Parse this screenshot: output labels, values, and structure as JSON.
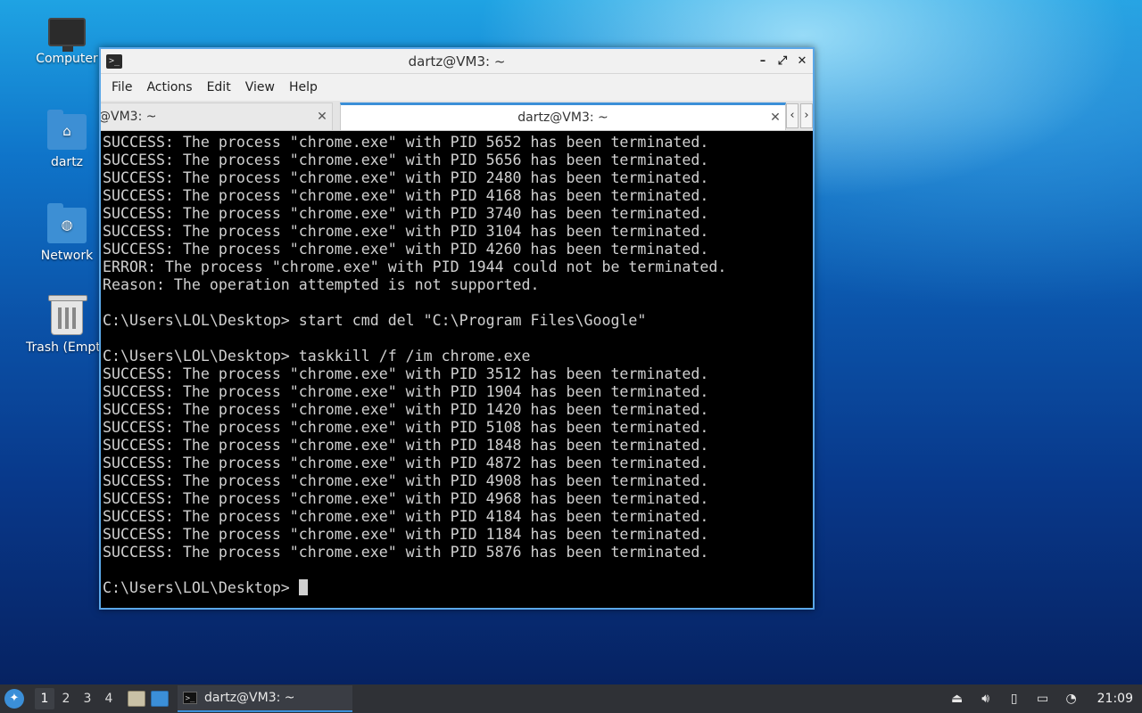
{
  "desktop": {
    "icons": [
      {
        "label": "Computer",
        "icon": "computer-icon"
      },
      {
        "label": "dartz",
        "icon": "home-folder-icon"
      },
      {
        "label": "Network",
        "icon": "network-folder-icon"
      },
      {
        "label": "Trash (Empt",
        "icon": "trash-icon"
      }
    ]
  },
  "window": {
    "title": "dartz@VM3: ~",
    "controls": {
      "minimize": "–",
      "maximize": "⤢",
      "close": "✕"
    },
    "menu": [
      "File",
      "Actions",
      "Edit",
      "View",
      "Help"
    ],
    "tabs": [
      {
        "label": "@VM3: ~",
        "close": "✕",
        "active": false
      },
      {
        "label": "dartz@VM3: ~",
        "close": "✕",
        "active": true
      }
    ],
    "tab_scroll": {
      "left": "‹",
      "right": "›"
    }
  },
  "terminal": {
    "lines": [
      "SUCCESS: The process \"chrome.exe\" with PID 5652 has been terminated.",
      "SUCCESS: The process \"chrome.exe\" with PID 5656 has been terminated.",
      "SUCCESS: The process \"chrome.exe\" with PID 2480 has been terminated.",
      "SUCCESS: The process \"chrome.exe\" with PID 4168 has been terminated.",
      "SUCCESS: The process \"chrome.exe\" with PID 3740 has been terminated.",
      "SUCCESS: The process \"chrome.exe\" with PID 3104 has been terminated.",
      "SUCCESS: The process \"chrome.exe\" with PID 4260 has been terminated.",
      "ERROR: The process \"chrome.exe\" with PID 1944 could not be terminated.",
      "Reason: The operation attempted is not supported.",
      "",
      "C:\\Users\\LOL\\Desktop> start cmd del \"C:\\Program Files\\Google\"",
      "",
      "C:\\Users\\LOL\\Desktop> taskkill /f /im chrome.exe",
      "SUCCESS: The process \"chrome.exe\" with PID 3512 has been terminated.",
      "SUCCESS: The process \"chrome.exe\" with PID 1904 has been terminated.",
      "SUCCESS: The process \"chrome.exe\" with PID 1420 has been terminated.",
      "SUCCESS: The process \"chrome.exe\" with PID 5108 has been terminated.",
      "SUCCESS: The process \"chrome.exe\" with PID 1848 has been terminated.",
      "SUCCESS: The process \"chrome.exe\" with PID 4872 has been terminated.",
      "SUCCESS: The process \"chrome.exe\" with PID 4908 has been terminated.",
      "SUCCESS: The process \"chrome.exe\" with PID 4968 has been terminated.",
      "SUCCESS: The process \"chrome.exe\" with PID 4184 has been terminated.",
      "SUCCESS: The process \"chrome.exe\" with PID 1184 has been terminated.",
      "SUCCESS: The process \"chrome.exe\" with PID 5876 has been terminated.",
      ""
    ],
    "prompt": "C:\\Users\\LOL\\Desktop> "
  },
  "taskbar": {
    "workspaces": [
      "1",
      "2",
      "3",
      "4"
    ],
    "active_workspace": "1",
    "task_label": "dartz@VM3: ~",
    "clock": "21:09"
  },
  "colors": {
    "accent": "#3b8fd8",
    "terminal_bg": "#000000",
    "terminal_fg": "#d0d0d0",
    "taskbar_bg": "#2f3136"
  }
}
